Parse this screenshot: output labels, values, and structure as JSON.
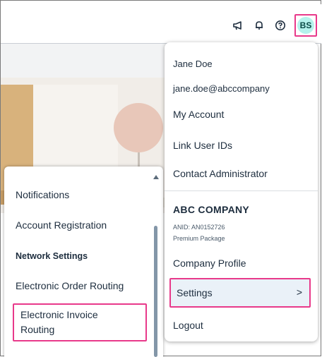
{
  "header": {
    "icons": [
      "megaphone-icon",
      "bell-icon",
      "help-icon"
    ],
    "avatar_initials": "BS"
  },
  "user_menu": {
    "user_name": "Jane Doe",
    "user_email": "jane.doe@abccompany",
    "items": [
      "My Account",
      "Link User IDs",
      "Contact Administrator"
    ],
    "company_name": "ABC COMPANY",
    "anid": "ANID: AN0152726",
    "package": "Premium Package",
    "company_profile": "Company Profile",
    "settings": "Settings",
    "settings_chevron": ">",
    "logout": "Logout"
  },
  "settings_submenu": {
    "items": [
      "Notifications",
      "Account Registration"
    ],
    "section_heading": "Network Settings",
    "order_routing": "Electronic Order Routing",
    "invoice_routing_line1": "Electronic Invoice",
    "invoice_routing_line2": "Routing"
  },
  "colors": {
    "highlight": "#e8398a",
    "avatar_bg": "#b5f2ec",
    "selected_bg": "#eaf1f8"
  }
}
